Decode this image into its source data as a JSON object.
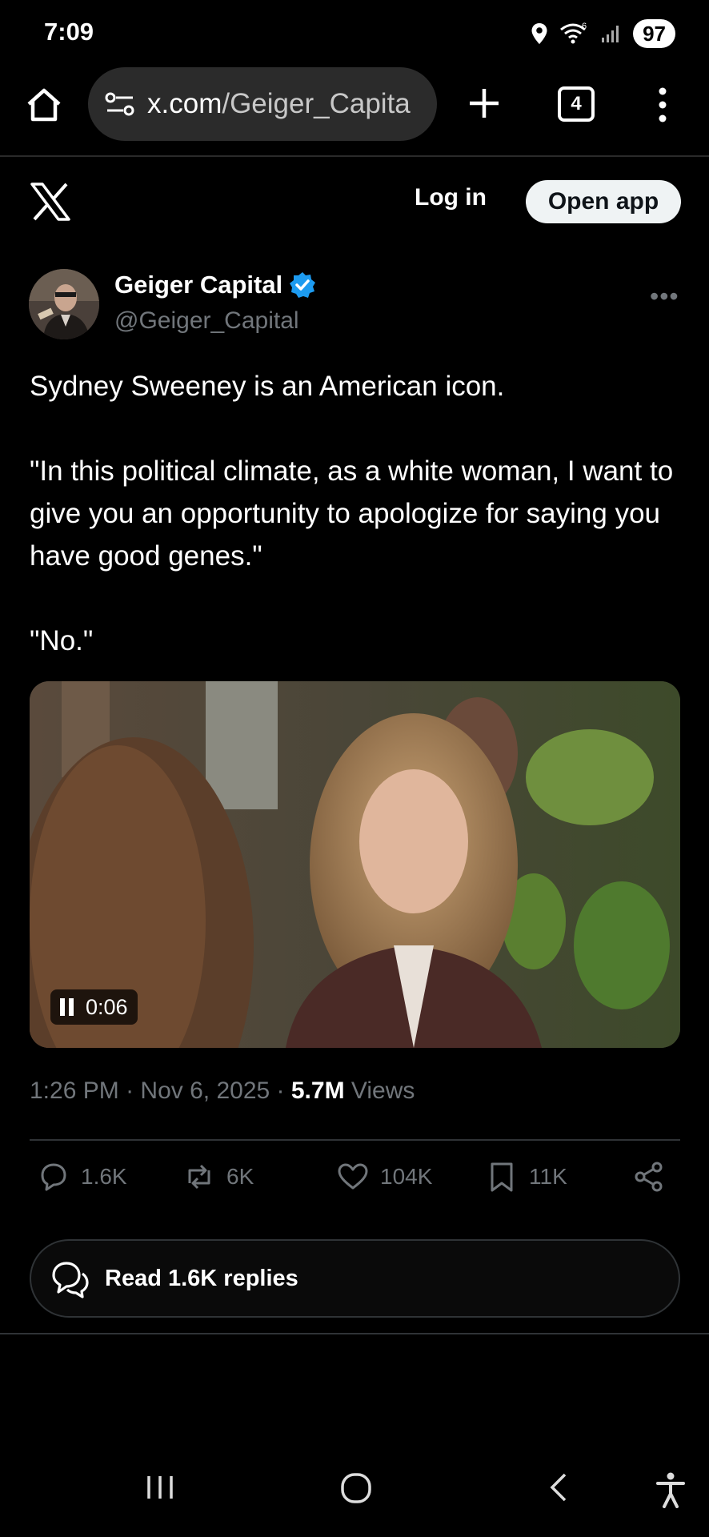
{
  "status_bar": {
    "time": "7:09",
    "battery": "97"
  },
  "browser": {
    "url_host": "x.com",
    "url_path": "/Geiger_Capita",
    "tab_count": "4"
  },
  "header": {
    "login_label": "Log in",
    "open_app_label": "Open app"
  },
  "tweet": {
    "author_name": "Geiger Capital",
    "author_handle": "@Geiger_Capital",
    "text": {
      "line1": "Sydney Sweeney is an American icon.",
      "line2": "\"In this political climate, as a white woman, I want to give you an opportunity to apologize for saying you have good genes.\"",
      "line3": "\"No.\""
    },
    "video_time": "0:06",
    "time": "1:26 PM",
    "date": "Nov 6, 2025",
    "views_count": "5.7M",
    "views_label": "Views",
    "replies": "1.6K",
    "reposts": "6K",
    "likes": "104K",
    "bookmarks": "11K",
    "read_replies_label": "Read 1.6K replies"
  },
  "colors": {
    "verified": "#1d9bf0",
    "muted": "#71767b",
    "background": "#000000"
  }
}
